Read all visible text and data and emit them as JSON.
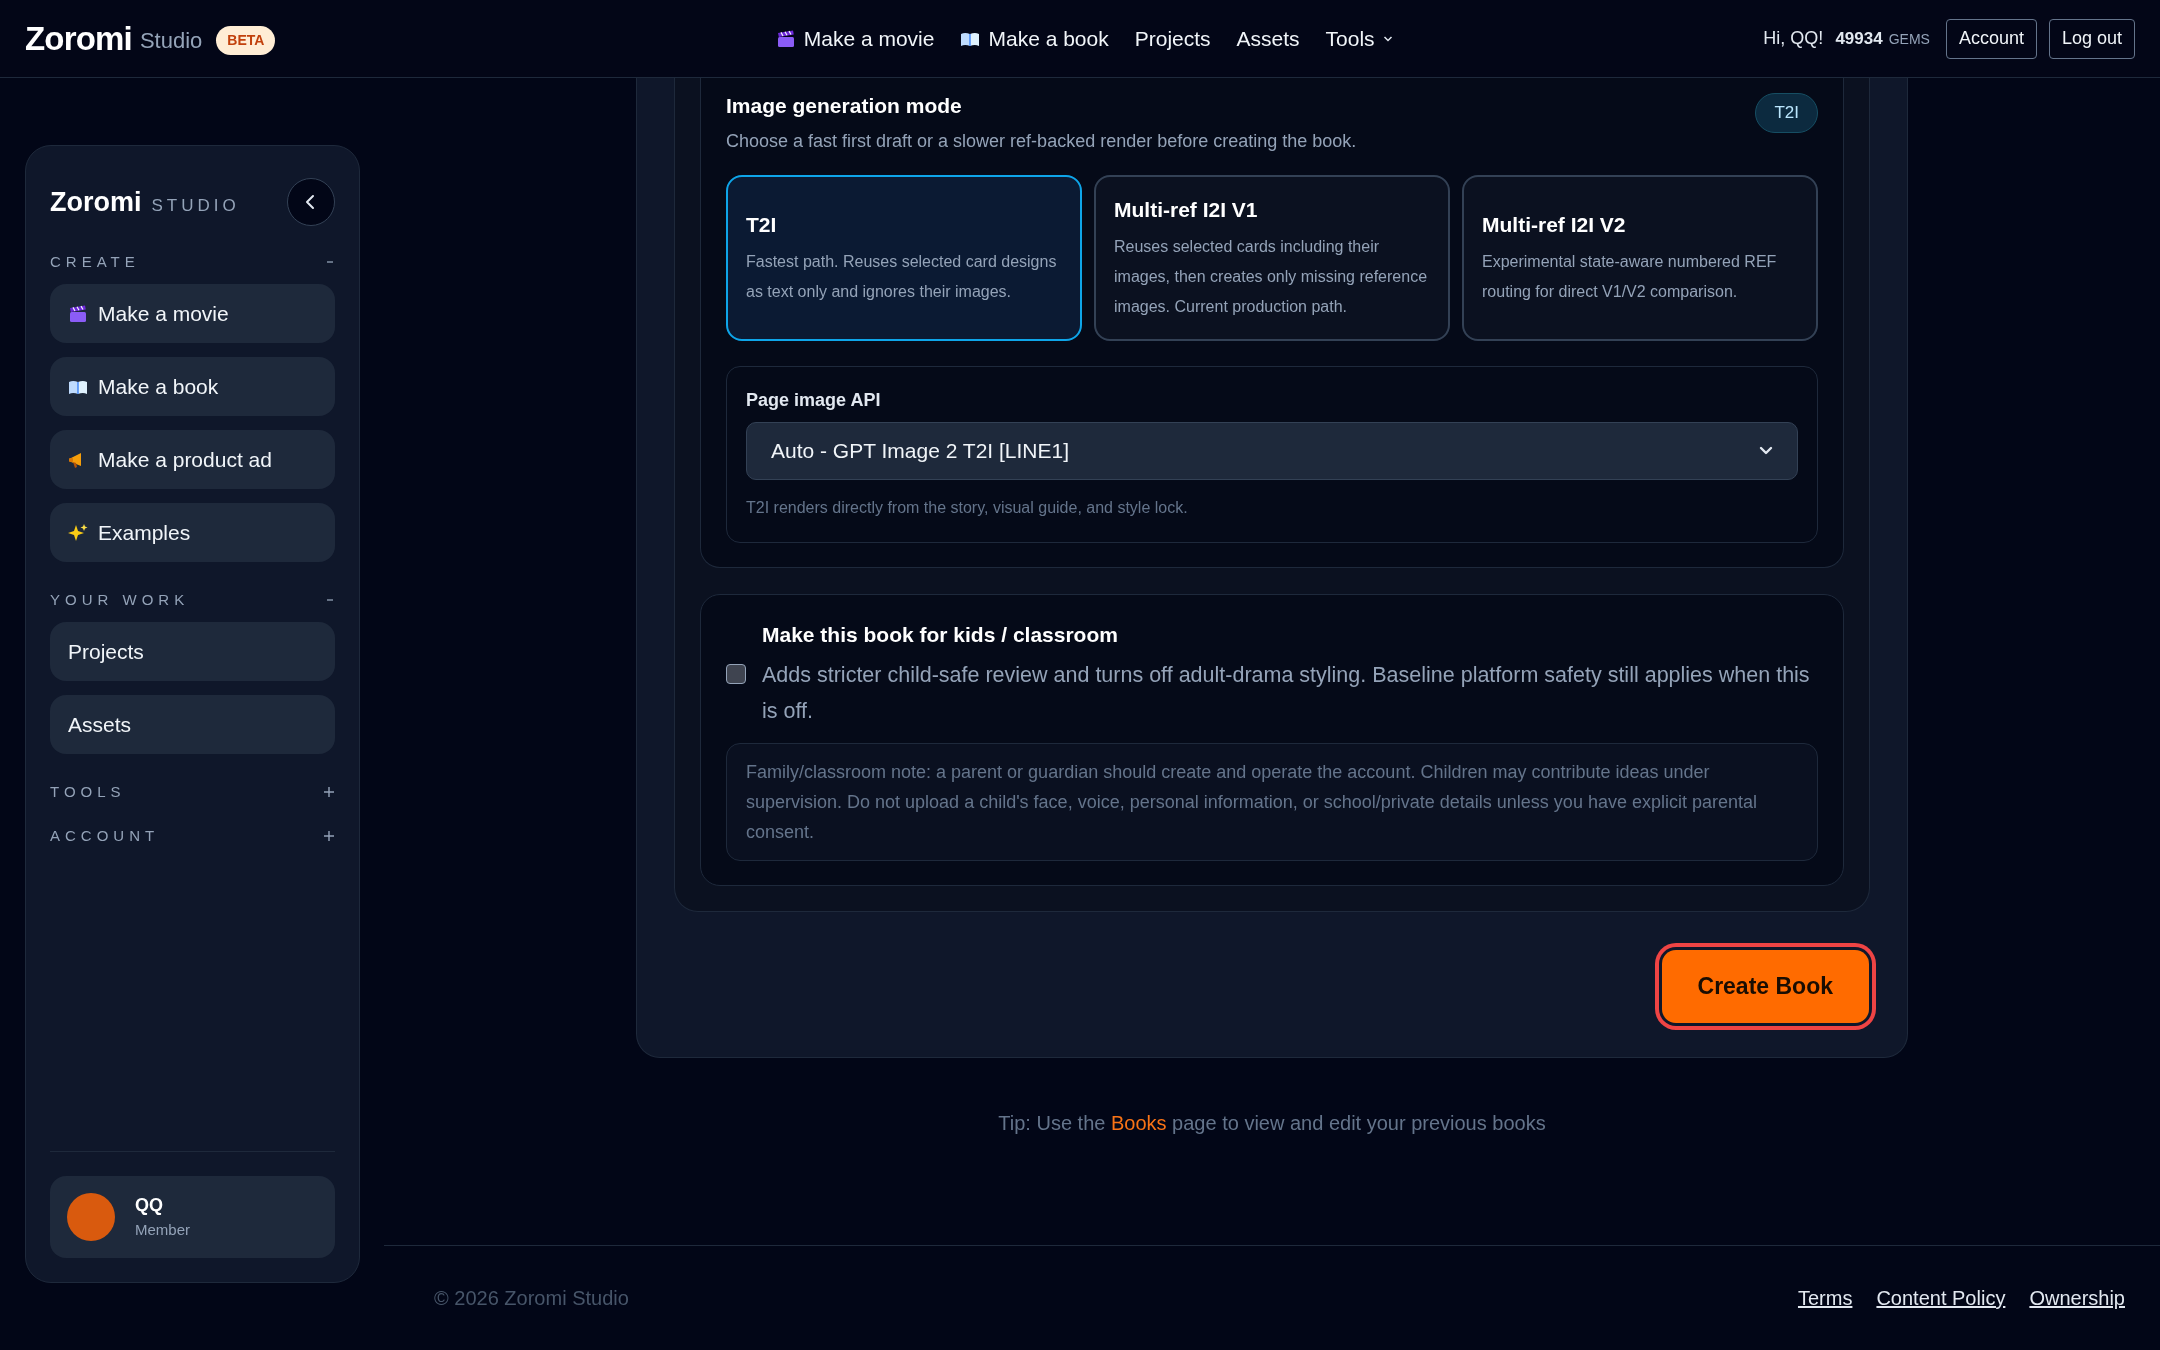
{
  "header": {
    "logo": "Zoromi",
    "logo_sub": "Studio",
    "badge": "BETA",
    "nav": [
      {
        "label": "Make a movie",
        "kind": "link"
      },
      {
        "label": "Make a book",
        "kind": "link"
      },
      {
        "label": "Projects",
        "kind": "link"
      },
      {
        "label": "Assets",
        "kind": "link"
      },
      {
        "label": "Tools",
        "kind": "dropdown"
      }
    ],
    "greeting": "Hi, QQ!",
    "gems": "49934",
    "gems_unit": "GEMS",
    "buttons": [
      "Account",
      "Log out"
    ]
  },
  "sidebar": {
    "logo": "Zoromi",
    "logo_sub": "STUDIO",
    "sections": [
      {
        "title": "CREATE",
        "expanded": true,
        "items": [
          "Make a movie",
          "Make a book",
          "Make a product ad",
          "Examples"
        ]
      },
      {
        "title": "YOUR WORK",
        "expanded": true,
        "items": [
          "Projects",
          "Assets"
        ]
      },
      {
        "title": "TOOLS",
        "expanded": false
      },
      {
        "title": "ACCOUNT",
        "expanded": false
      }
    ],
    "user": {
      "name": "QQ",
      "role": "Member"
    }
  },
  "mode_section": {
    "title": "Image generation mode",
    "badge": "T2I",
    "subtitle": "Choose a fast first draft or a slower ref-backed render before creating the book.",
    "options": [
      {
        "title": "T2I",
        "description": "Fastest path. Reuses selected card designs as text only and ignores their images.",
        "selected": true
      },
      {
        "title": "Multi-ref I2I V1",
        "description": "Reuses selected cards including their images, then creates only missing reference images. Current production path.",
        "selected": false
      },
      {
        "title": "Multi-ref I2I V2",
        "description": "Experimental state-aware numbered REF routing for direct V1/V2 comparison.",
        "selected": false
      }
    ],
    "api": {
      "label": "Page image API",
      "value": "Auto - GPT Image 2 T2I [LINE1]",
      "hint": "T2I renders directly from the story, visual guide, and style lock."
    }
  },
  "kids_section": {
    "title": "Make this book for kids / classroom",
    "checked": false,
    "description": "Adds stricter child-safe review and turns off adult-drama styling. Baseline platform safety still applies when this is off.",
    "note": "Family/classroom note: a parent or guardian should create and operate the account. Children may contribute ideas under supervision. Do not upload a child's face, voice, personal information, or school/private details unless you have explicit parental consent."
  },
  "create_button": "Create Book",
  "tip": {
    "before": "Tip: Use the",
    "link": "Books",
    "after": "page to view and edit your previous books"
  },
  "footer": {
    "copyright": "© 2026 Zoromi Studio",
    "links": [
      "Terms",
      "Content Policy",
      "Ownership"
    ]
  }
}
